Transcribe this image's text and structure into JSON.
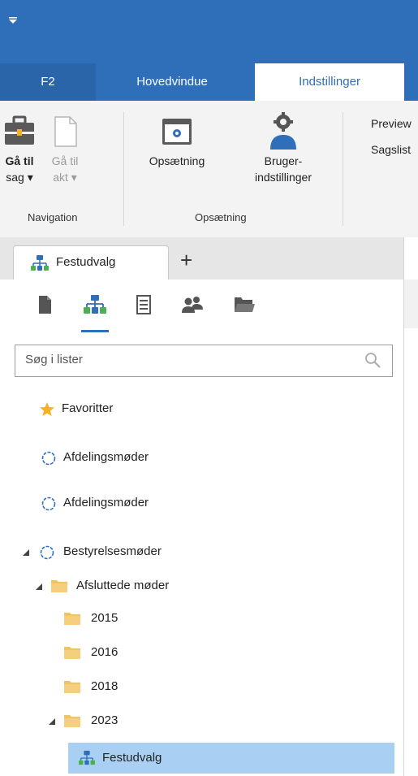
{
  "ribbon_tabs": [
    "F2",
    "Hovedvindue",
    "Indstillinger"
  ],
  "ribbon": {
    "goto_case": "Gå til sag ▾",
    "goto_case_line1": "Gå til",
    "goto_case_line2": "sag ▾",
    "goto_doc_line1": "Gå til",
    "goto_doc_line2": "akt ▾",
    "setup": "Opsætning",
    "user_settings_line1": "Bruger-",
    "user_settings_line2": "indstillinger",
    "group_navigation": "Navigation",
    "group_setup": "Opsætning",
    "preview": "Preview",
    "caselist": "Sagslist"
  },
  "doc_tab": {
    "label": "Festudvalg",
    "add": "+"
  },
  "search": {
    "placeholder": "Søg i lister"
  },
  "tree": {
    "favorites": "Favoritter",
    "item1": "Afdelingsmøder",
    "item2": "Afdelingsmøder",
    "item3": "Bestyrelsesmøder",
    "item4": "Afsluttede møder",
    "y2015": "2015",
    "y2016": "2016",
    "y2018": "2018",
    "y2023": "2023",
    "selected": "Festudvalg"
  },
  "colors": {
    "accent": "#2f6fba",
    "selection": "#a9d0f2",
    "folder": "#f0c36a",
    "star": "#f5b324"
  }
}
